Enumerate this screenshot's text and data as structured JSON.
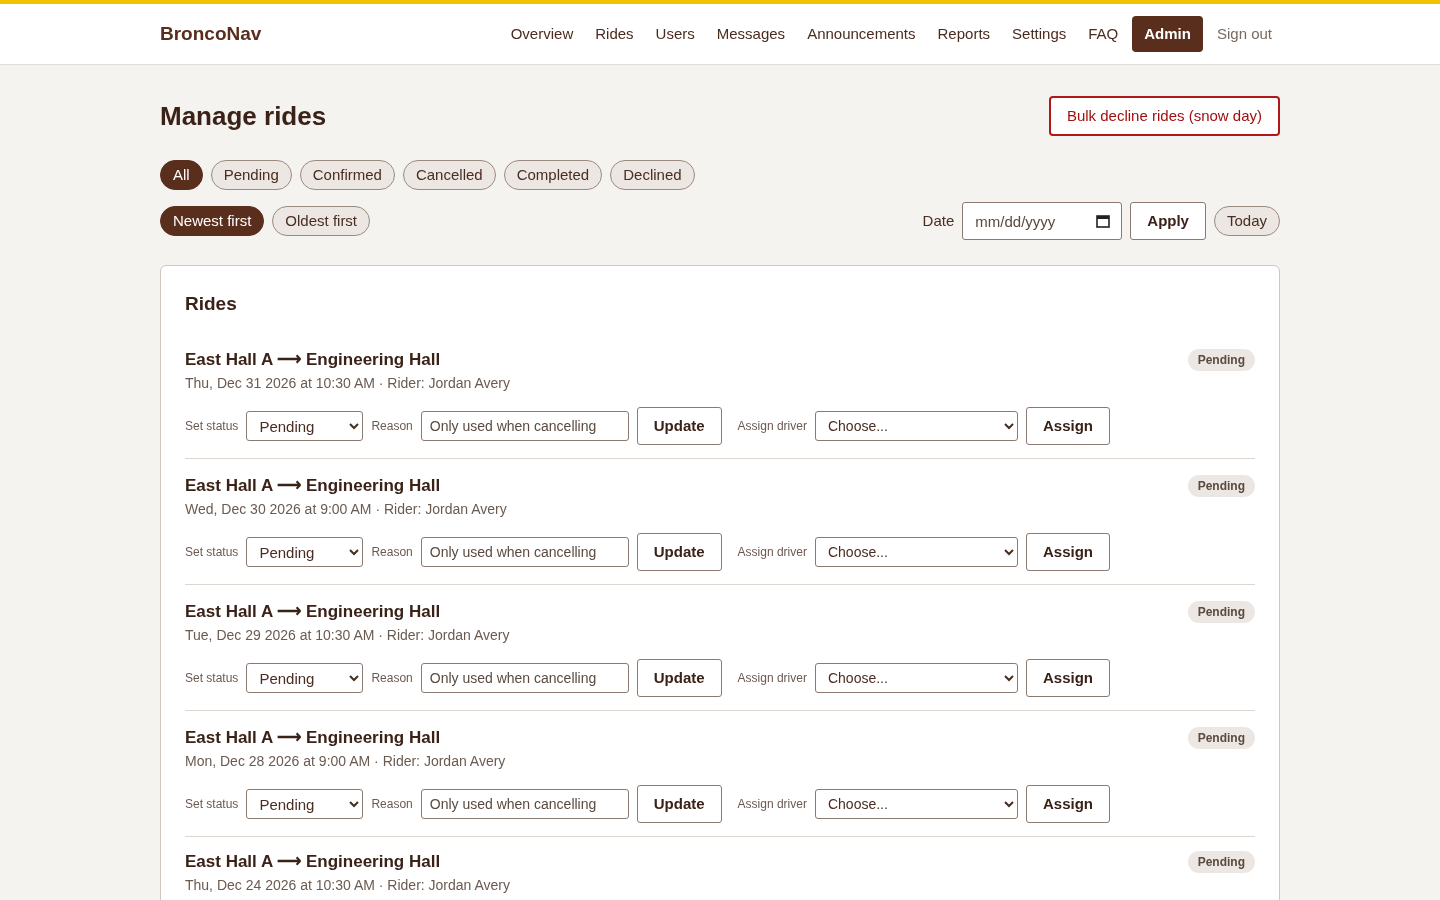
{
  "brand": "BroncoNav",
  "nav": [
    {
      "label": "Overview",
      "selected": false
    },
    {
      "label": "Rides",
      "selected": false
    },
    {
      "label": "Users",
      "selected": false
    },
    {
      "label": "Messages",
      "selected": false
    },
    {
      "label": "Announcements",
      "selected": false
    },
    {
      "label": "Reports",
      "selected": false
    },
    {
      "label": "Settings",
      "selected": false
    },
    {
      "label": "FAQ",
      "selected": false
    },
    {
      "label": "Admin",
      "selected": true
    },
    {
      "label": "Sign out",
      "selected": false
    }
  ],
  "page_title": "Manage rides",
  "bulk_button": "Bulk decline rides (snow day)",
  "status_filters": [
    {
      "label": "All",
      "selected": true
    },
    {
      "label": "Pending",
      "selected": false
    },
    {
      "label": "Confirmed",
      "selected": false
    },
    {
      "label": "Cancelled",
      "selected": false
    },
    {
      "label": "Completed",
      "selected": false
    },
    {
      "label": "Declined",
      "selected": false
    }
  ],
  "sort": [
    {
      "label": "Newest first",
      "selected": true
    },
    {
      "label": "Oldest first",
      "selected": false
    }
  ],
  "date_filter": {
    "label": "Date",
    "placeholder": "mm/dd/yyyy",
    "apply": "Apply",
    "today": "Today"
  },
  "card_title": "Rides",
  "rides": [
    {
      "route": "East Hall A ⟶ Engineering Hall",
      "meta": "Thu, Dec 31 2026 at 10:30 AM · Rider: Jordan Avery",
      "badge": "Pending",
      "controls": {
        "status_label": "Set status",
        "status": "Pending",
        "reason_label": "Reason",
        "reason_placeholder": "Only used when cancelling",
        "update": "Update",
        "driver_label": "Assign driver",
        "driver": "Choose...",
        "assign": "Assign"
      }
    },
    {
      "route": "East Hall A ⟶ Engineering Hall",
      "meta": "Wed, Dec 30 2026 at 9:00 AM · Rider: Jordan Avery",
      "badge": "Pending",
      "controls": {
        "status_label": "Set status",
        "status": "Pending",
        "reason_label": "Reason",
        "reason_placeholder": "Only used when cancelling",
        "update": "Update",
        "driver_label": "Assign driver",
        "driver": "Choose...",
        "assign": "Assign"
      }
    },
    {
      "route": "East Hall A ⟶ Engineering Hall",
      "meta": "Tue, Dec 29 2026 at 10:30 AM · Rider: Jordan Avery",
      "badge": "Pending",
      "controls": {
        "status_label": "Set status",
        "status": "Pending",
        "reason_label": "Reason",
        "reason_placeholder": "Only used when cancelling",
        "update": "Update",
        "driver_label": "Assign driver",
        "driver": "Choose...",
        "assign": "Assign"
      }
    },
    {
      "route": "East Hall A ⟶ Engineering Hall",
      "meta": "Mon, Dec 28 2026 at 9:00 AM · Rider: Jordan Avery",
      "badge": "Pending",
      "controls": {
        "status_label": "Set status",
        "status": "Pending",
        "reason_label": "Reason",
        "reason_placeholder": "Only used when cancelling",
        "update": "Update",
        "driver_label": "Assign driver",
        "driver": "Choose...",
        "assign": "Assign"
      }
    },
    {
      "route": "East Hall A ⟶ Engineering Hall",
      "meta": "Thu, Dec 24 2026 at 10:30 AM · Rider: Jordan Avery",
      "badge": "Pending"
    }
  ]
}
